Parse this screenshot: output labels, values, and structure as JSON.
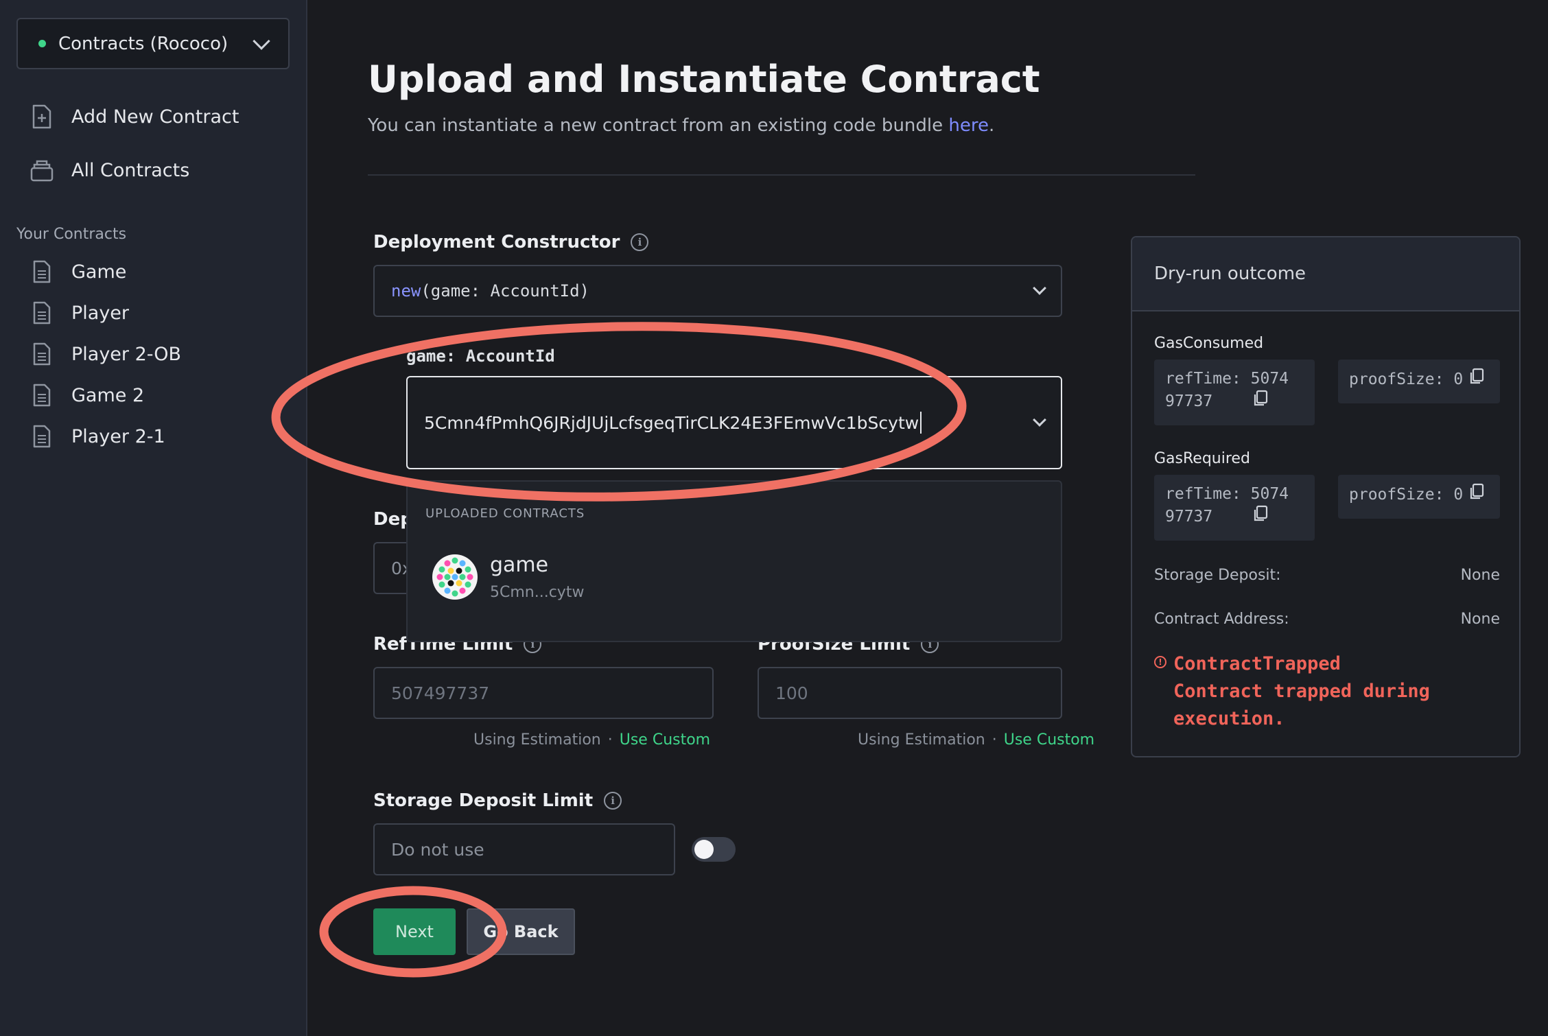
{
  "sidebar": {
    "network": "Contracts (Rococo)",
    "nav": [
      {
        "label": "Add New Contract"
      },
      {
        "label": "All Contracts"
      }
    ],
    "section_label": "Your Contracts",
    "contracts": [
      {
        "label": "Game"
      },
      {
        "label": "Player"
      },
      {
        "label": "Player 2-OB"
      },
      {
        "label": "Game 2"
      },
      {
        "label": "Player 2-1"
      }
    ]
  },
  "main": {
    "title": "Upload and Instantiate Contract",
    "subtitle": "You can instantiate a new contract from an existing code bundle ",
    "subtitle_link": "here",
    "subtitle_end": ".",
    "constructor_label": "Deployment Constructor",
    "constructor_kw": "new",
    "constructor_sig": "(game: AccountId)",
    "param_label": "game: AccountId",
    "account_value": "5Cmn4fPmhQ6JRjdJUjLcfsgeqTirCLK24E3FEmwVc1bScytw",
    "dropdown": {
      "header": "UPLOADED CONTRACTS",
      "item_name": "game",
      "item_addr": "5Cmn...cytw"
    },
    "hidden_label": "Dep",
    "hidden_value": "0x",
    "reftime_label": "RefTime Limit",
    "reftime_placeholder": "507497737",
    "proofsize_label": "ProofSize Limit",
    "proofsize_placeholder": "100",
    "using_estimation": "Using Estimation",
    "use_custom": "Use Custom",
    "storage_label": "Storage Deposit Limit",
    "storage_placeholder": "Do not use",
    "next_label": "Next",
    "back_label": "Go Back"
  },
  "panel": {
    "title": "Dry-run outcome",
    "gas_consumed_label": "GasConsumed",
    "gas_required_label": "GasRequired",
    "reftime_line1": "refTime: 5074",
    "reftime_line2": "97737",
    "proofsize_text": "proofSize: 0",
    "storage_deposit_label": "Storage Deposit:",
    "storage_deposit_value": "None",
    "contract_address_label": "Contract Address:",
    "contract_address_value": "None",
    "error_title": "ContractTrapped",
    "error_message": "Contract trapped during execution."
  },
  "colors": {
    "accent_green": "#3fd58a",
    "button_green": "#1f8a5a",
    "link_blue": "#7e8cff",
    "error_red": "#f0645a",
    "annotation_red": "#f07164"
  },
  "icons": [
    "chevron-down-icon",
    "file-plus-icon",
    "archive-icon",
    "document-icon",
    "info-icon",
    "copy-icon",
    "error-icon"
  ]
}
